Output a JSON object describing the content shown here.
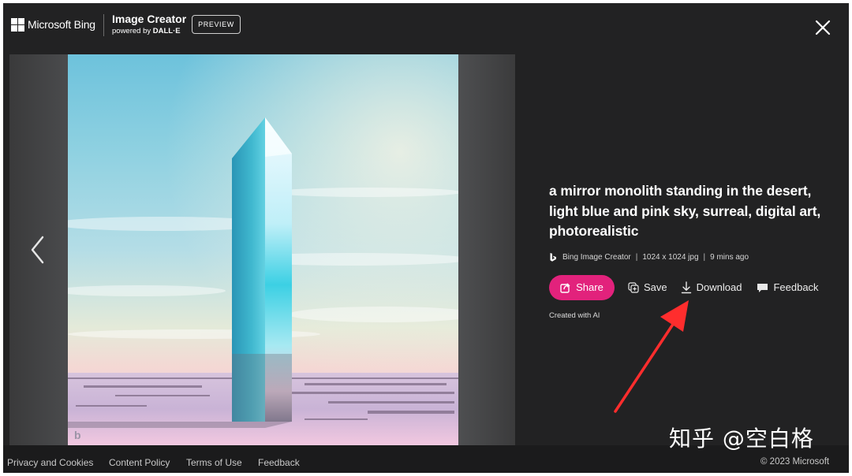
{
  "header": {
    "brand": "Microsoft Bing",
    "app_title": "Image Creator",
    "app_sub_prefix": "powered by",
    "app_sub_model": "DALL·E",
    "badge": "PREVIEW",
    "close_icon": "close-icon"
  },
  "viewer": {
    "prev_icon": "chevron-left-icon",
    "image_watermark": "b"
  },
  "details": {
    "prompt": "a mirror monolith standing in the desert, light blue and pink sky, surreal, digital art, photorealistic",
    "source": "Bing Image Creator",
    "resolution": "1024 x 1024 jpg",
    "age": "9 mins ago",
    "separator": "|",
    "actions": {
      "share": "Share",
      "save": "Save",
      "download": "Download",
      "feedback": "Feedback"
    },
    "created_with": "Created with AI"
  },
  "footer": {
    "links": [
      "Privacy and Cookies",
      "Content Policy",
      "Terms of Use",
      "Feedback"
    ],
    "copyright": "© 2023 Microsoft"
  },
  "watermark_text": "知乎 @空白格",
  "colors": {
    "background": "#222223",
    "share_accent": "#e2227c",
    "annotation_arrow": "#ff2d2d"
  }
}
